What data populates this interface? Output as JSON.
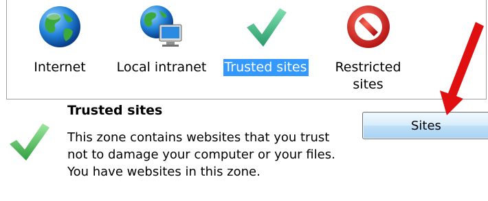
{
  "zones": [
    {
      "id": "internet",
      "label": "Internet",
      "icon": "globe-icon"
    },
    {
      "id": "intranet",
      "label": "Local intranet",
      "icon": "globe-computer-icon"
    },
    {
      "id": "trusted",
      "label": "Trusted sites",
      "icon": "checkmark-icon",
      "selected": true
    },
    {
      "id": "restricted",
      "label": "Restricted sites",
      "icon": "no-entry-icon"
    }
  ],
  "selected_zone": {
    "title": "Trusted sites",
    "description_line1": "This zone contains websites that you trust not to damage your computer or your files.",
    "description_line2": "You have websites in this zone."
  },
  "sites_button_label": "Sites",
  "colors": {
    "selection": "#3399ff",
    "checkmark": "#3cb46e",
    "restricted": "#d42020",
    "arrow": "#e01010"
  }
}
